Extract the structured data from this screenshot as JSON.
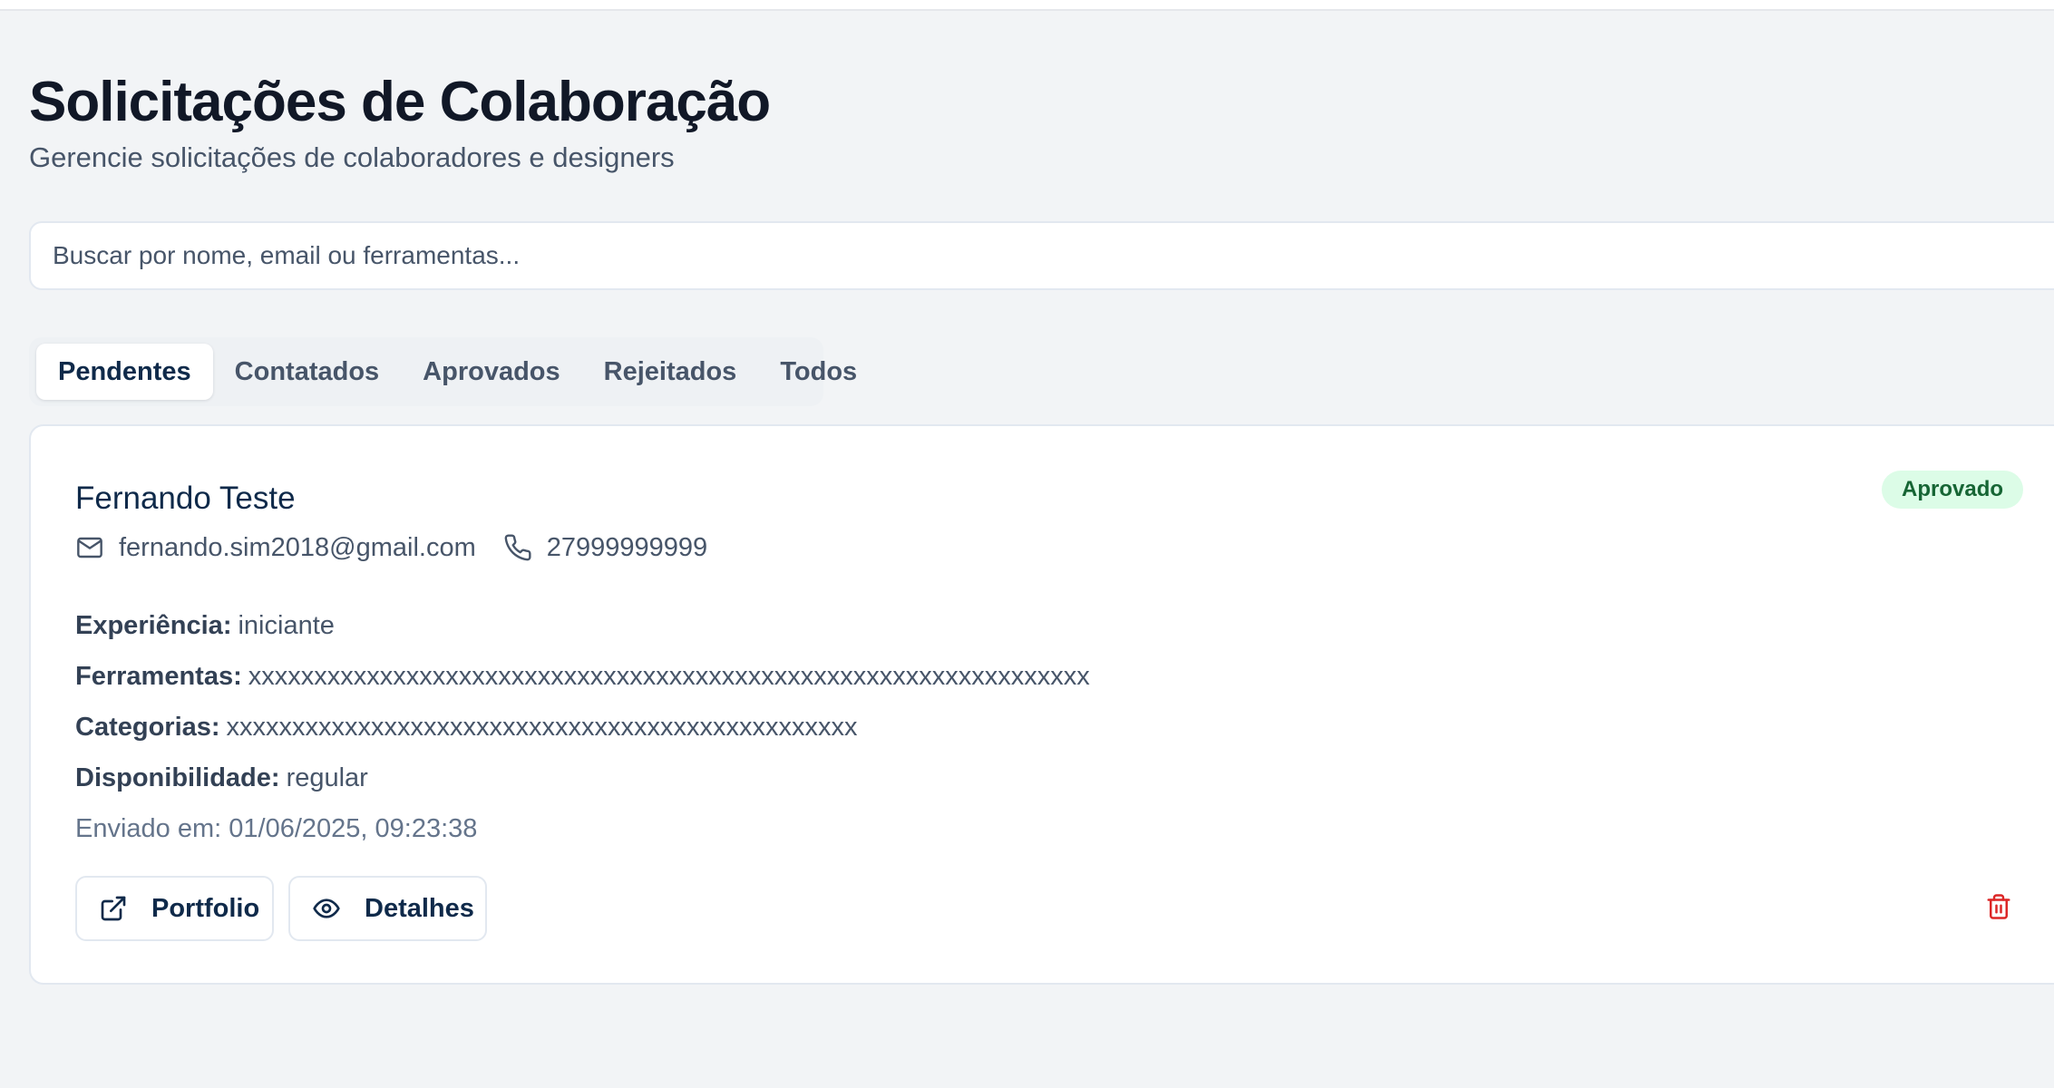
{
  "header": {
    "title": "Solicitações de Colaboração",
    "subtitle": "Gerencie solicitações de colaboradores e designers"
  },
  "search": {
    "placeholder": "Buscar por nome, email ou ferramentas...",
    "value": ""
  },
  "tabs": [
    {
      "label": "Pendentes",
      "active": true
    },
    {
      "label": "Contatados",
      "active": false
    },
    {
      "label": "Aprovados",
      "active": false
    },
    {
      "label": "Rejeitados",
      "active": false
    },
    {
      "label": "Todos",
      "active": false
    }
  ],
  "request": {
    "name": "Fernando Teste",
    "status": "Aprovado",
    "email": "fernando.sim2018@gmail.com",
    "phone": "27999999999",
    "fields": [
      {
        "label": "Experiência:",
        "value": "iniciante"
      },
      {
        "label": "Ferramentas:",
        "value": "xxxxxxxxxxxxxxxxxxxxxxxxxxxxxxxxxxxxxxxxxxxxxxxxxxxxxxxxxxxxxxxx"
      },
      {
        "label": "Categorias:",
        "value": "xxxxxxxxxxxxxxxxxxxxxxxxxxxxxxxxxxxxxxxxxxxxxxxx"
      },
      {
        "label": "Disponibilidade:",
        "value": "regular"
      }
    ],
    "submitted": "Enviado em: 01/06/2025, 09:23:38"
  },
  "actions": {
    "portfolio_label": "Portfolio",
    "details_label": "Detalhes"
  },
  "icons": {
    "email": "mail-icon",
    "phone": "phone-icon",
    "portfolio": "external-link-icon",
    "details": "eye-icon",
    "delete": "trash-icon"
  },
  "colors": {
    "status_bg": "#dcfce7",
    "status_text": "#166534",
    "delete": "#dc2626"
  }
}
